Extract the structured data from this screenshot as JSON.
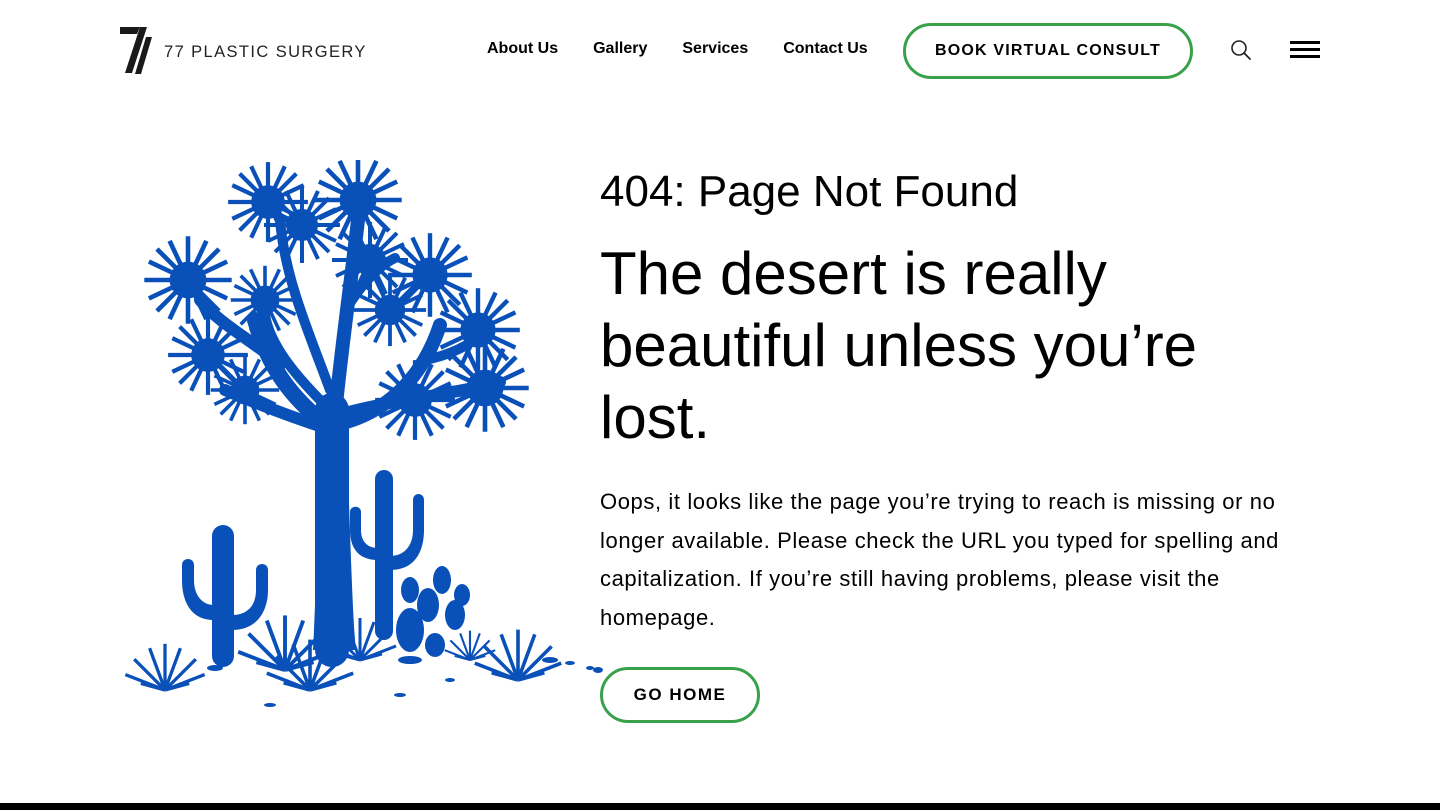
{
  "header": {
    "logo_text": "77 PLASTIC SURGERY",
    "nav": [
      {
        "label": "About Us"
      },
      {
        "label": "Gallery"
      },
      {
        "label": "Services"
      },
      {
        "label": "Contact Us"
      }
    ],
    "cta_label": "BOOK VIRTUAL CONSULT",
    "search_icon": "search-icon",
    "menu_icon": "hamburger-menu-icon"
  },
  "main": {
    "error_title": "404: Page Not Found",
    "headline": "The desert is really beautiful unless you’re lost.",
    "body": "Oops, it looks like the page you’re trying to reach is missing or no longer available. Please check the URL you typed for spelling and capitalization. If you’re still having problems, please visit the homepage.",
    "home_button": "GO HOME",
    "illustration": "desert-joshua-tree-cactus-illustration"
  },
  "colors": {
    "accent_green": "#3aa14b",
    "illustration_blue": "#0a50b9",
    "text": "#000000",
    "background": "#ffffff"
  }
}
